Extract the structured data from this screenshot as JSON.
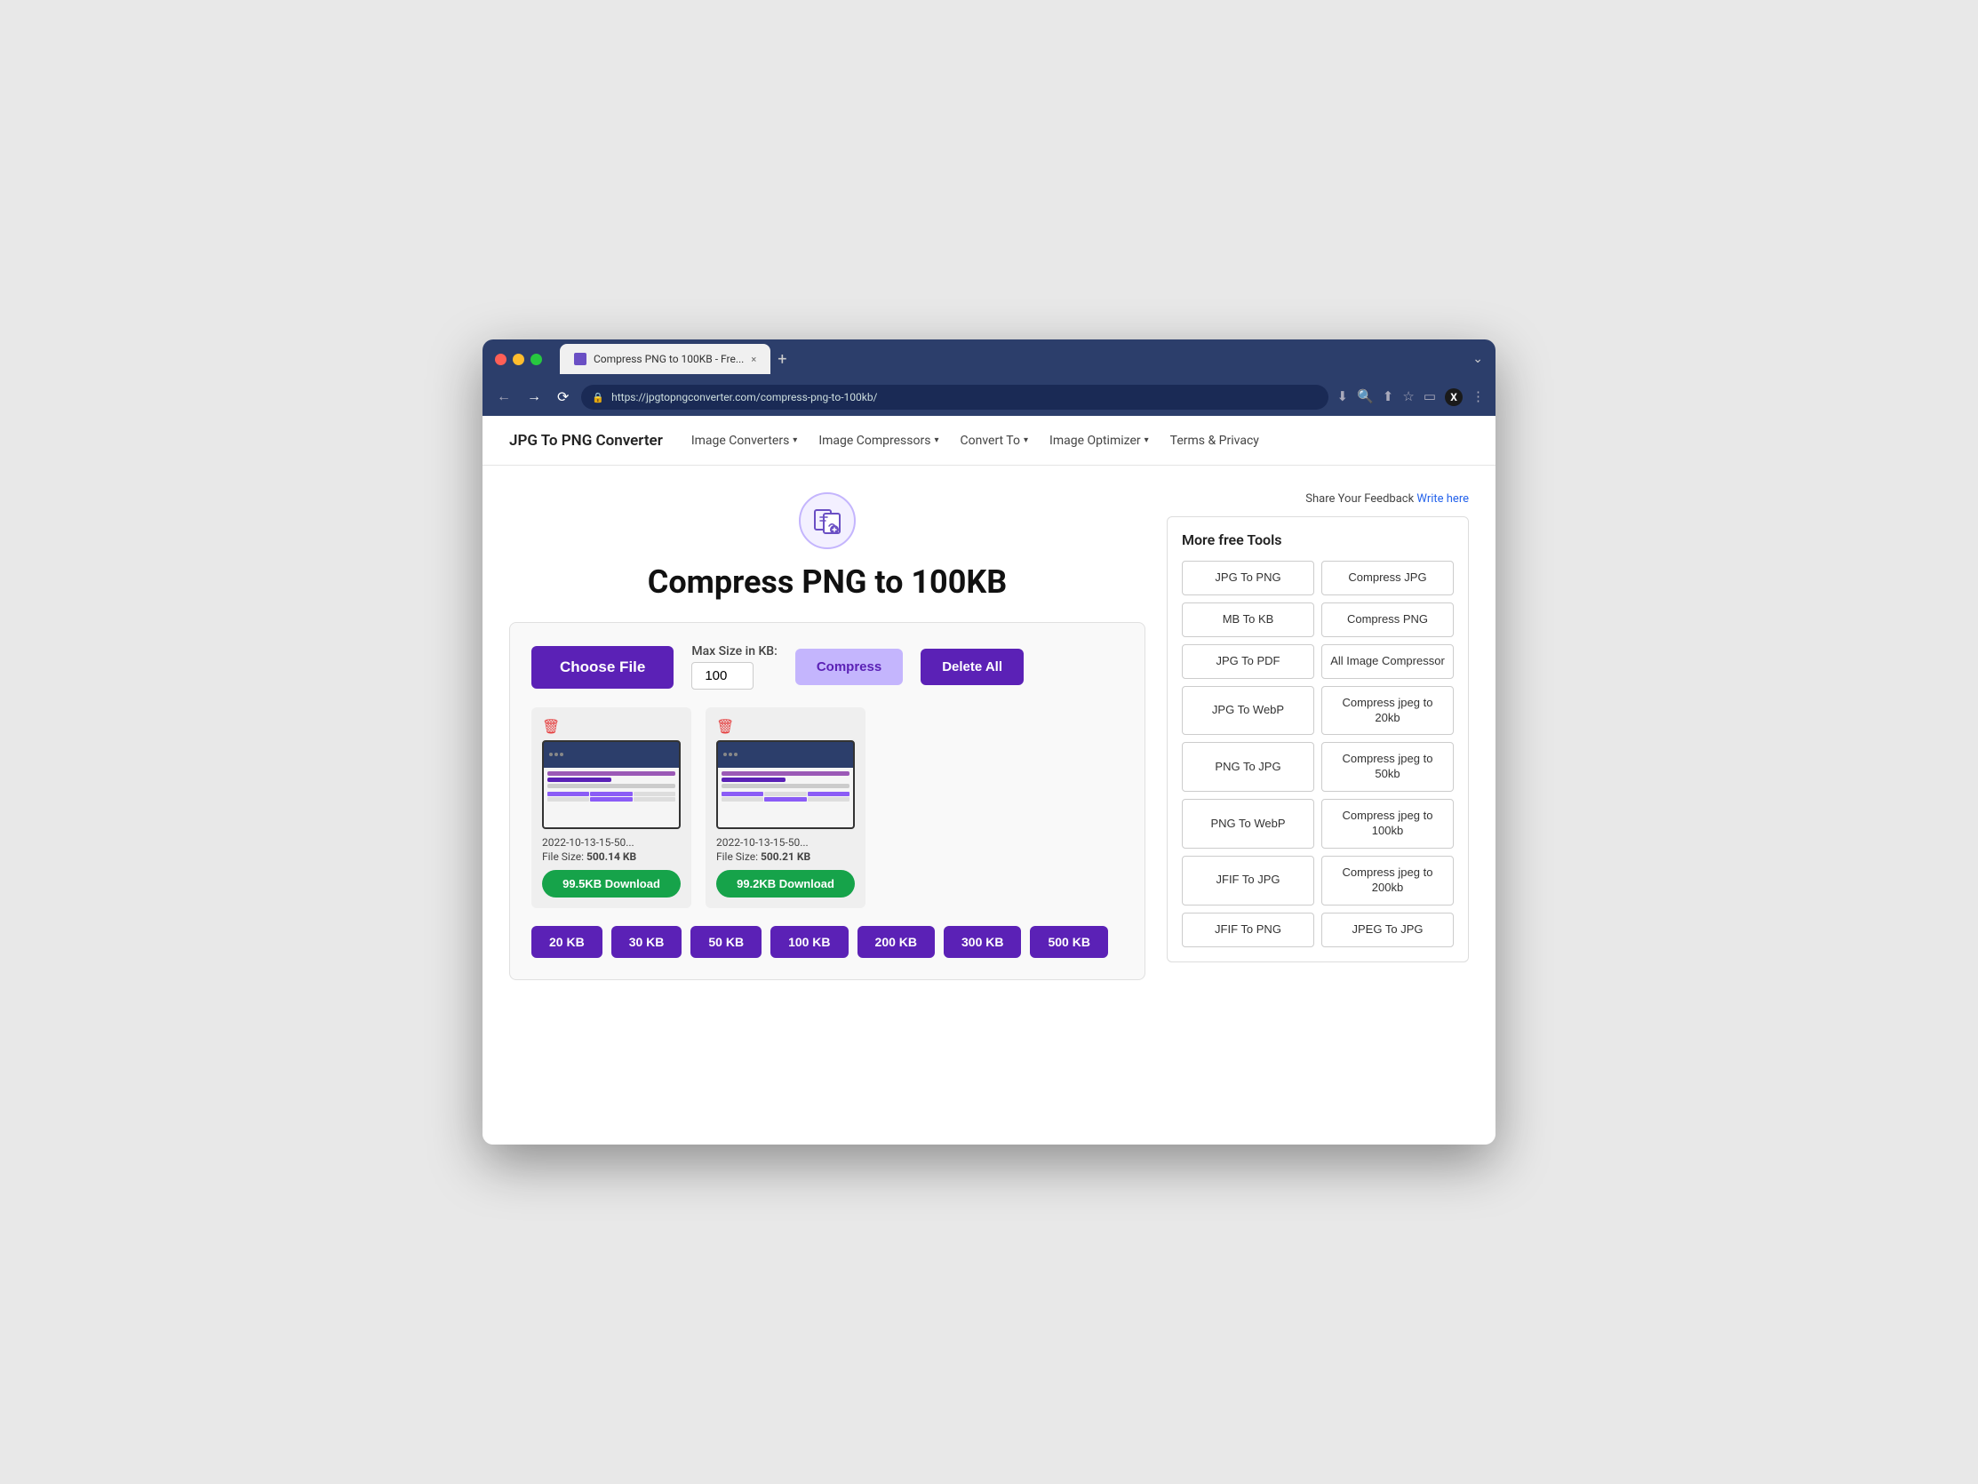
{
  "browser": {
    "tab_title": "Compress PNG to 100KB - Fre...",
    "url": "https://jpgtopngconverter.com/compress-png-to-100kb/",
    "tab_close": "×",
    "tab_new": "+"
  },
  "nav": {
    "logo": "JPG To PNG Converter",
    "links": [
      {
        "label": "Image Converters",
        "has_dropdown": true
      },
      {
        "label": "Image Compressors",
        "has_dropdown": true
      },
      {
        "label": "Convert To",
        "has_dropdown": true
      },
      {
        "label": "Image Optimizer",
        "has_dropdown": true
      },
      {
        "label": "Terms & Privacy",
        "has_dropdown": false
      }
    ]
  },
  "hero": {
    "title": "Compress PNG to 100KB",
    "icon_label": "compress-icon"
  },
  "tool": {
    "choose_file_label": "Choose File",
    "max_size_label": "Max Size in KB:",
    "max_size_value": "100",
    "compress_label": "Compress",
    "delete_all_label": "Delete All",
    "cards": [
      {
        "filename": "2022-10-13-15-50...",
        "filesize_label": "File Size:",
        "filesize": "500.14 KB",
        "download_size": "99.5KB",
        "download_label": "Download"
      },
      {
        "filename": "2022-10-13-15-50...",
        "filesize_label": "File Size:",
        "filesize": "500.21 KB",
        "download_size": "99.2KB",
        "download_label": "Download"
      }
    ],
    "presets": [
      "20 KB",
      "30 KB",
      "50 KB",
      "100 KB",
      "200 KB",
      "300 KB",
      "500 KB"
    ]
  },
  "sidebar": {
    "feedback_text": "Share Your Feedback",
    "feedback_link": "Write here",
    "more_tools_title": "More free Tools",
    "tools": [
      {
        "label": "JPG To PNG",
        "col": 1
      },
      {
        "label": "Compress JPG",
        "col": 2
      },
      {
        "label": "MB To KB",
        "col": 1
      },
      {
        "label": "Compress PNG",
        "col": 2
      },
      {
        "label": "JPG To PDF",
        "col": 1
      },
      {
        "label": "All Image Compressor",
        "col": 2
      },
      {
        "label": "JPG To WebP",
        "col": 1
      },
      {
        "label": "Compress jpeg to 20kb",
        "col": 2
      },
      {
        "label": "PNG To JPG",
        "col": 1
      },
      {
        "label": "Compress jpeg to 50kb",
        "col": 2
      },
      {
        "label": "PNG To WebP",
        "col": 1
      },
      {
        "label": "Compress jpeg to 100kb",
        "col": 2
      },
      {
        "label": "JFIF To JPG",
        "col": 1
      },
      {
        "label": "Compress jpeg to 200kb",
        "col": 2
      },
      {
        "label": "JFIF To PNG",
        "col": 1
      },
      {
        "label": "JPEG To JPG",
        "col": 1
      }
    ]
  }
}
